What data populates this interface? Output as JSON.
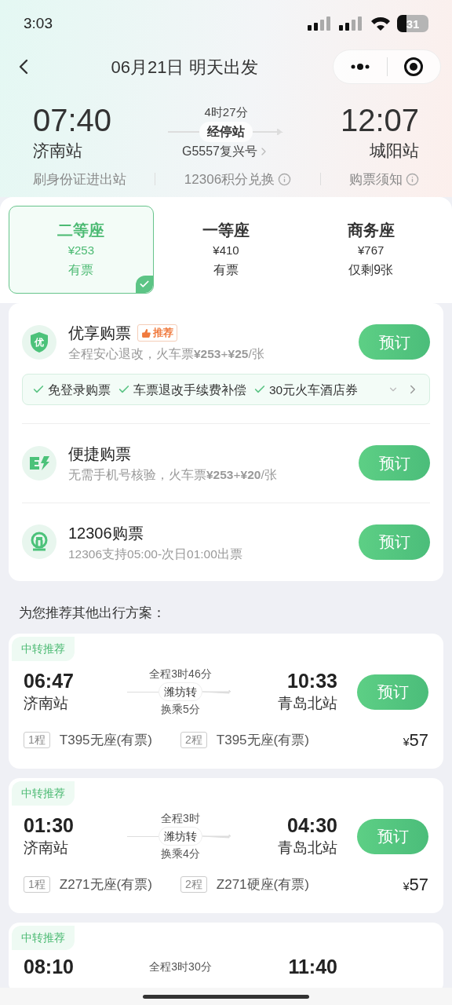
{
  "status_bar": {
    "time": "3:03",
    "battery": "31"
  },
  "nav": {
    "title": "06月21日 明天出发"
  },
  "train": {
    "depart_time": "07:40",
    "depart_station": "济南站",
    "duration": "4时27分",
    "stops_label": "经停站",
    "train_no": "G5557复兴号",
    "arrive_time": "12:07",
    "arrive_station": "城阳站"
  },
  "links": [
    {
      "label": "刷身份证进出站",
      "info": false
    },
    {
      "label": "12306积分兑换",
      "info": true
    },
    {
      "label": "购票须知",
      "info": true
    }
  ],
  "seats": [
    {
      "name": "二等座",
      "price": "¥253",
      "availability": "有票",
      "selected": true
    },
    {
      "name": "一等座",
      "price": "¥410",
      "availability": "有票",
      "selected": false
    },
    {
      "name": "商务座",
      "price": "¥767",
      "availability": "仅剩9张",
      "selected": false
    }
  ],
  "options": [
    {
      "kind": "shield",
      "icon_text": "优",
      "title": "优享购票",
      "tag": "推荐",
      "desc": "全程安心退改，火车票**¥253**+**¥25**/张",
      "button": "预订",
      "features": [
        "免登录购票",
        "车票退改手续费补偿",
        "30元火车酒店券"
      ]
    },
    {
      "kind": "lightning",
      "title": "便捷购票",
      "desc": "无需手机号核验，火车票**¥253**+**¥20**/张",
      "button": "预订"
    },
    {
      "kind": "railway",
      "title": "12306购票",
      "desc": "12306支持05:00-次日01:00出票",
      "button": "预订"
    }
  ],
  "recommend_heading": "为您推荐其他出行方案：",
  "transfers": [
    {
      "tag": "中转推荐",
      "depart_time": "06:47",
      "depart_station": "济南站",
      "total": "全程3时46分",
      "via": "潍坊转",
      "wait": "换乘5分",
      "arrive_time": "10:33",
      "arrive_station": "青岛北站",
      "button": "预订",
      "legs": [
        {
          "label": "1程",
          "train": "T395无座(有票)"
        },
        {
          "label": "2程",
          "train": "T395无座(有票)"
        }
      ],
      "currency": "¥",
      "price": "57"
    },
    {
      "tag": "中转推荐",
      "depart_time": "01:30",
      "depart_station": "济南站",
      "total": "全程3时",
      "via": "潍坊转",
      "wait": "换乘4分",
      "arrive_time": "04:30",
      "arrive_station": "青岛北站",
      "button": "预订",
      "legs": [
        {
          "label": "1程",
          "train": "Z271无座(有票)"
        },
        {
          "label": "2程",
          "train": "Z271硬座(有票)"
        }
      ],
      "currency": "¥",
      "price": "57"
    },
    {
      "tag": "中转推荐",
      "depart_time": "08:10",
      "total": "全程3时30分",
      "arrive_time": "11:40"
    }
  ]
}
